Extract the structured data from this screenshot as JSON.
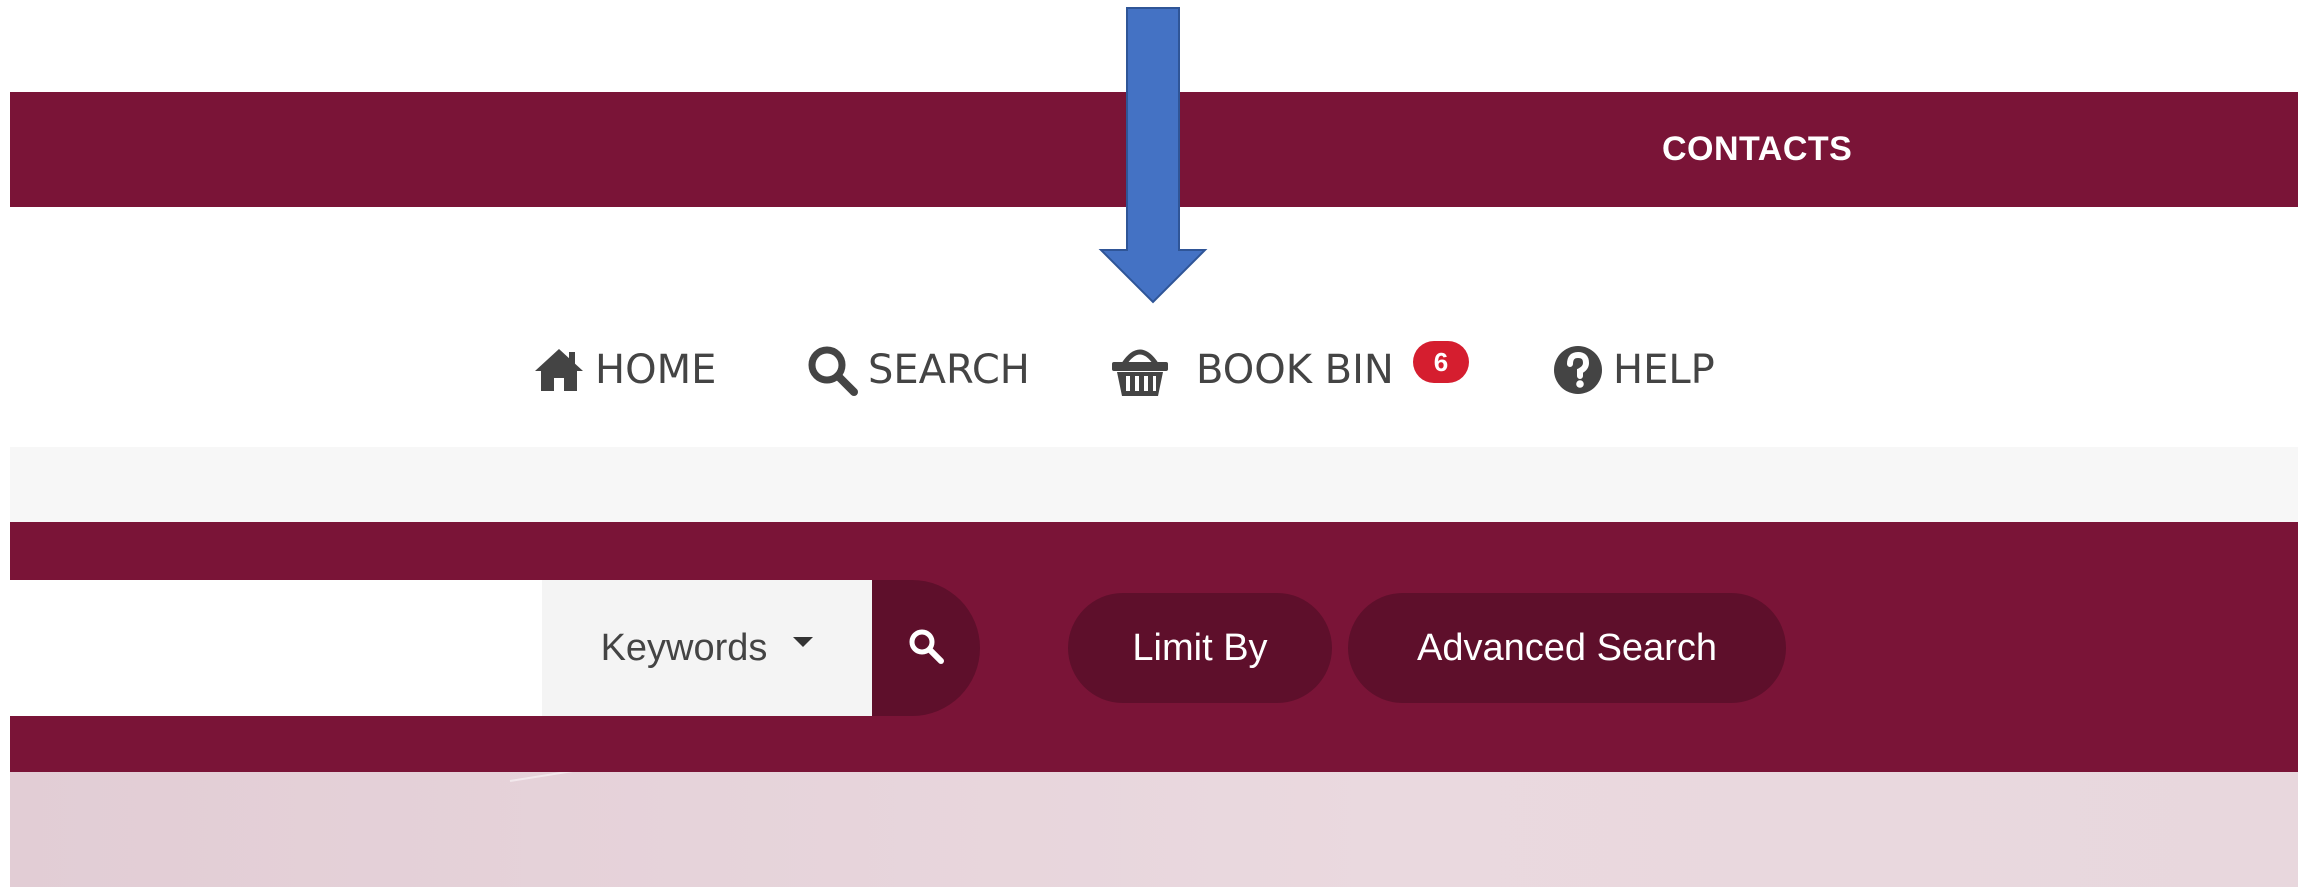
{
  "top_bar": {
    "contacts_label": "CONTACTS"
  },
  "nav": {
    "home": {
      "label": "HOME",
      "icon": "home-icon"
    },
    "search": {
      "label": "SEARCH",
      "icon": "search-icon"
    },
    "book_bin": {
      "label": "BOOK BIN",
      "icon": "basket-icon",
      "badge": "6"
    },
    "help": {
      "label": "HELP",
      "icon": "question-circle-icon"
    }
  },
  "search_bar": {
    "input_value": "",
    "search_type": "Keywords",
    "search_button_icon": "search-icon"
  },
  "buttons": {
    "limit_by": "Limit By",
    "advanced_search": "Advanced Search"
  },
  "annotation": {
    "arrow_color": "#4472c4",
    "points_to": "book-bin"
  },
  "colors": {
    "brand": "#7a1437",
    "brand_dark": "#5e0f2b",
    "badge": "#d51e2f",
    "nav_text": "#444444"
  }
}
